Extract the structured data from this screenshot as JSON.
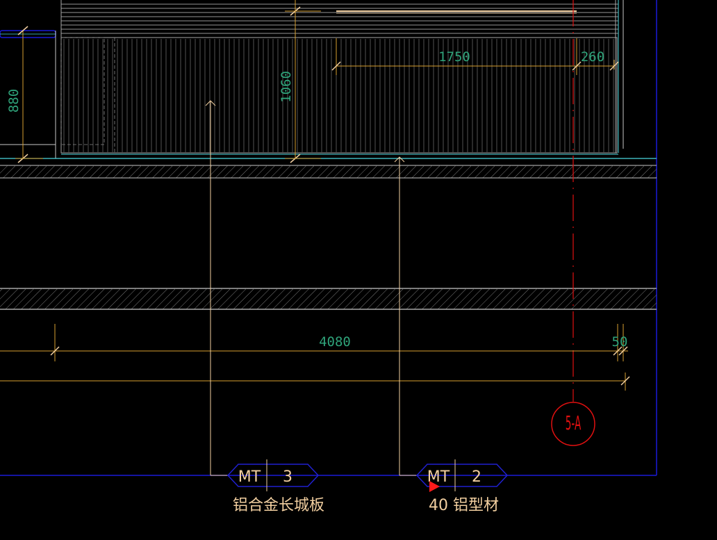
{
  "dimensions": {
    "d880": "880",
    "d1060": "1060",
    "d1750": "1750",
    "d260": "260",
    "d4080": "4080",
    "d50": "50"
  },
  "tags": [
    {
      "code": "MT",
      "number": "3",
      "note": "铝合金长城板"
    },
    {
      "code": "MT",
      "number": "2",
      "note": "40 铝型材"
    }
  ],
  "axis_marker": {
    "label": "5-A"
  },
  "colors": {
    "background": "#000000",
    "dimension_line": "#d8a030",
    "dimension_text": "#2fa37a",
    "leader": "#f2cfa0",
    "tag_outline": "#2020d0",
    "frame": "#1a1ad8",
    "cyan": "#4ad8e0",
    "axis": "#e01010",
    "hatch": "#9a9a9a"
  }
}
